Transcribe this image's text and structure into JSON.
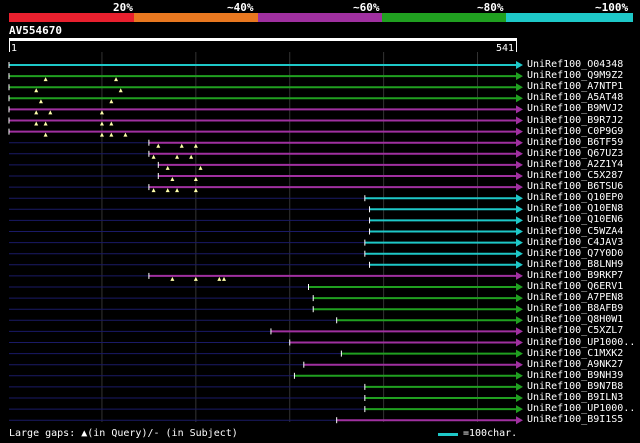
{
  "identity_legend": {
    "labels": [
      "20%",
      "~40%",
      "~60%",
      "~80%",
      "~100%"
    ],
    "colors": [
      "#e8202e",
      "#e87820",
      "#a030a0",
      "#20a020",
      "#1ec8c8"
    ]
  },
  "query": {
    "id": "AV554670",
    "start": "1",
    "end": "541"
  },
  "hits": [
    {
      "name": "UniRef100_O04348",
      "color": "#1ec8c8",
      "start": 1,
      "gaps": []
    },
    {
      "name": "UniRef100_Q9M9Z2",
      "color": "#20a020",
      "start": 1,
      "gaps": [
        40,
        115
      ]
    },
    {
      "name": "UniRef100_A7NTP1",
      "color": "#20a020",
      "start": 1,
      "gaps": [
        30,
        120
      ]
    },
    {
      "name": "UniRef100_A5AT48",
      "color": "#20a020",
      "start": 1,
      "gaps": [
        35,
        110
      ]
    },
    {
      "name": "UniRef100_B9MVJ2",
      "color": "#a030a0",
      "start": 1,
      "gaps": [
        30,
        45,
        100
      ]
    },
    {
      "name": "UniRef100_B9R7J2",
      "color": "#a030a0",
      "start": 1,
      "gaps": [
        30,
        40,
        100,
        110
      ]
    },
    {
      "name": "UniRef100_C0P9G9",
      "color": "#a030a0",
      "start": 1,
      "gaps": [
        40,
        100,
        110,
        125
      ]
    },
    {
      "name": "UniRef100_B6TF59",
      "color": "#a030a0",
      "start": 150,
      "gaps": [
        160,
        185,
        200
      ]
    },
    {
      "name": "UniRef100_Q67UZ3",
      "color": "#a030a0",
      "start": 150,
      "gaps": [
        155,
        180,
        195
      ]
    },
    {
      "name": "UniRef100_A2Z1Y4",
      "color": "#a030a0",
      "start": 160,
      "gaps": [
        170,
        205
      ]
    },
    {
      "name": "UniRef100_C5X287",
      "color": "#a030a0",
      "start": 160,
      "gaps": [
        175,
        200
      ]
    },
    {
      "name": "UniRef100_B6TSU6",
      "color": "#a030a0",
      "start": 150,
      "gaps": [
        155,
        170,
        180,
        200
      ]
    },
    {
      "name": "UniRef100_Q10EP0",
      "color": "#1ec8c8",
      "start": 380,
      "gaps": []
    },
    {
      "name": "UniRef100_Q10EN8",
      "color": "#1ec8c8",
      "start": 385,
      "gaps": []
    },
    {
      "name": "UniRef100_Q10EN6",
      "color": "#1ec8c8",
      "start": 385,
      "gaps": []
    },
    {
      "name": "UniRef100_C5WZA4",
      "color": "#1ec8c8",
      "start": 385,
      "gaps": []
    },
    {
      "name": "UniRef100_C4JAV3",
      "color": "#1ec8c8",
      "start": 380,
      "gaps": []
    },
    {
      "name": "UniRef100_Q7Y0D0",
      "color": "#1ec8c8",
      "start": 380,
      "gaps": []
    },
    {
      "name": "UniRef100_B8LNH9",
      "color": "#1ec8c8",
      "start": 385,
      "gaps": []
    },
    {
      "name": "UniRef100_B9RKP7",
      "color": "#a030a0",
      "start": 150,
      "gaps": [
        175,
        200,
        225,
        230
      ]
    },
    {
      "name": "UniRef100_Q6ERV1",
      "color": "#20a020",
      "start": 320,
      "gaps": []
    },
    {
      "name": "UniRef100_A7PEN8",
      "color": "#20a020",
      "start": 325,
      "gaps": []
    },
    {
      "name": "UniRef100_B8AFB9",
      "color": "#20a020",
      "start": 325,
      "gaps": []
    },
    {
      "name": "UniRef100_Q8H0W1",
      "color": "#20a020",
      "start": 350,
      "gaps": []
    },
    {
      "name": "UniRef100_C5XZL7",
      "color": "#a030a0",
      "start": 280,
      "gaps": []
    },
    {
      "name": "UniRef100_UP1000..",
      "color": "#a030a0",
      "start": 300,
      "gaps": []
    },
    {
      "name": "UniRef100_C1MXK2",
      "color": "#20a020",
      "start": 355,
      "gaps": []
    },
    {
      "name": "UniRef100_A9NK27",
      "color": "#a030a0",
      "start": 315,
      "gaps": []
    },
    {
      "name": "UniRef100_B9NH39",
      "color": "#20a020",
      "start": 305,
      "gaps": []
    },
    {
      "name": "UniRef100_B9N7B8",
      "color": "#20a020",
      "start": 380,
      "gaps": []
    },
    {
      "name": "UniRef100_B9ILN3",
      "color": "#20a020",
      "start": 380,
      "gaps": []
    },
    {
      "name": "UniRef100_UP1000..2",
      "color": "#20a020",
      "start": 380,
      "gaps": []
    },
    {
      "name": "UniRef100_B9I1S5",
      "color": "#a030a0",
      "start": 350,
      "gaps": []
    }
  ],
  "hit_labels": [
    "UniRef100_O04348",
    "UniRef100_Q9M9Z2",
    "UniRef100_A7NTP1",
    "UniRef100_A5AT48",
    "UniRef100_B9MVJ2",
    "UniRef100_B9R7J2",
    "UniRef100_C0P9G9",
    "UniRef100_B6TF59",
    "UniRef100_Q67UZ3",
    "UniRef100_A2Z1Y4",
    "UniRef100_C5X287",
    "UniRef100_B6TSU6",
    "UniRef100_Q10EP0",
    "UniRef100_Q10EN8",
    "UniRef100_Q10EN6",
    "UniRef100_C5WZA4",
    "UniRef100_C4JAV3",
    "UniRef100_Q7Y0D0",
    "UniRef100_B8LNH9",
    "UniRef100_B9RKP7",
    "UniRef100_Q6ERV1",
    "UniRef100_A7PEN8",
    "UniRef100_B8AFB9",
    "UniRef100_Q8H0W1",
    "UniRef100_C5XZL7",
    "UniRef100_UP1000..",
    "UniRef100_C1MXK2",
    "UniRef100_A9NK27",
    "UniRef100_B9NH39",
    "UniRef100_B9N7B8",
    "UniRef100_B9ILN3",
    "UniRef100_UP1000..",
    "UniRef100_B9I1S5"
  ],
  "footer": {
    "gaps_note": "Large gaps: ▲(in Query)/- (in Subject)",
    "scale_note": "=100char."
  }
}
